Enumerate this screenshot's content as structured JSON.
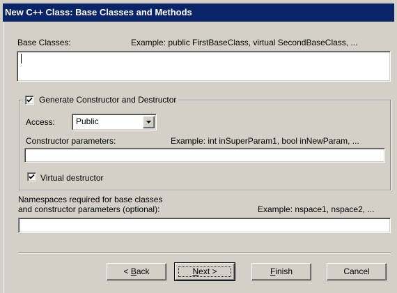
{
  "window": {
    "title": "New C++ Class: Base Classes and Methods"
  },
  "base_classes": {
    "label": "Base Classes:",
    "example": "Example: public FirstBaseClass, virtual SecondBaseClass, ...",
    "value": ""
  },
  "generate_group": {
    "checkbox_label": "Generate Constructor and Destructor",
    "checked": true,
    "access_label": "Access:",
    "access_value": "Public",
    "ctor_params_label": "Constructor parameters:",
    "ctor_params_example": "Example: int inSuperParam1, bool inNewParam, ...",
    "ctor_params_value": "",
    "virtual_dtor_label": "Virtual destructor",
    "virtual_dtor_checked": true
  },
  "namespaces": {
    "label_line1": "Namespaces required for base classes",
    "label_line2": "and constructor parameters (optional):",
    "example": "Example: nspace1, nspace2, ...",
    "value": ""
  },
  "buttons": {
    "back_prefix": "< ",
    "back_mnemonic": "B",
    "back_rest": "ack",
    "next_mnemonic": "N",
    "next_rest": "ext >",
    "finish_mnemonic": "F",
    "finish_rest": "inish",
    "cancel": "Cancel"
  },
  "colors": {
    "title_bar_bg": "#0a246a",
    "dialog_bg": "#d4d0c8"
  },
  "icons": {
    "checkmark": "check-icon",
    "dropdown": "chevron-down-icon"
  }
}
